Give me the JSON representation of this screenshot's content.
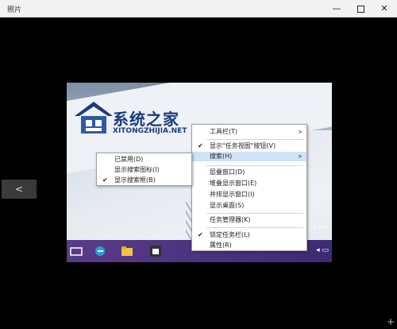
{
  "window": {
    "title": "照片"
  },
  "photo": {
    "logo_name": "系统之家",
    "logo_url": "XITONGZHIJIA.NET",
    "watermark": "10 Pro"
  },
  "context_menu": {
    "items": [
      {
        "label": "工具栏(T)",
        "checked": false,
        "submenu": true
      },
      {
        "label": "显示\"任务视图\"按钮(V)",
        "checked": true,
        "submenu": false
      },
      {
        "label": "搜索(H)",
        "checked": false,
        "submenu": true,
        "highlighted": true
      },
      {
        "label": "层叠窗口(D)",
        "checked": false
      },
      {
        "label": "堆叠显示窗口(E)",
        "checked": false
      },
      {
        "label": "并排显示窗口(I)",
        "checked": false
      },
      {
        "label": "显示桌面(S)",
        "checked": false
      },
      {
        "label": "任务管理器(K)",
        "checked": false
      },
      {
        "label": "锁定任务栏(L)",
        "checked": true
      },
      {
        "label": "属性(R)",
        "checked": false
      }
    ]
  },
  "search_submenu": {
    "items": [
      {
        "label": "已禁用(D)",
        "checked": false
      },
      {
        "label": "显示搜索图标(I)",
        "checked": false
      },
      {
        "label": "显示搜索框(B)",
        "checked": true
      }
    ]
  },
  "glyphs": {
    "check": "✔",
    "arrow": ">",
    "prev": "<",
    "minimize": "—",
    "close": "✕",
    "expand": "+"
  }
}
